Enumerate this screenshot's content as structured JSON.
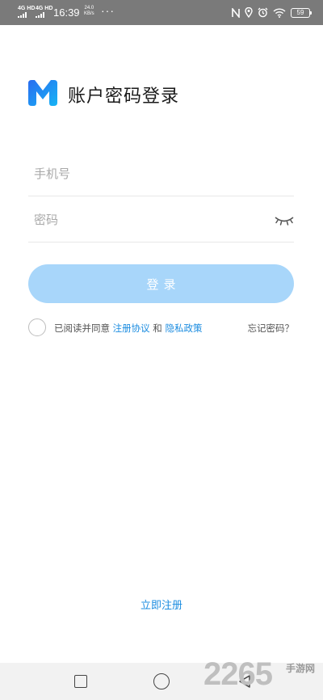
{
  "status_bar": {
    "network_1": "4G HD",
    "network_2": "4G HD",
    "time": "16:39",
    "speed_value": "24.0",
    "speed_unit": "KB/s",
    "more": "···",
    "battery": "59"
  },
  "header": {
    "title": "账户密码登录"
  },
  "form": {
    "phone_placeholder": "手机号",
    "password_placeholder": "密码",
    "login_label": "登录"
  },
  "agreement": {
    "prefix": "已阅读并同意 ",
    "terms_link": "注册协议",
    "and": " 和 ",
    "privacy_link": "隐私政策",
    "forgot_password": "忘记密码？"
  },
  "footer": {
    "register_link": "立即注册"
  },
  "watermark": {
    "number": "2265",
    "suffix": "手游网"
  },
  "colors": {
    "brand_blue": "#1b8ce0",
    "button_disabled": "#a8d6fa"
  }
}
